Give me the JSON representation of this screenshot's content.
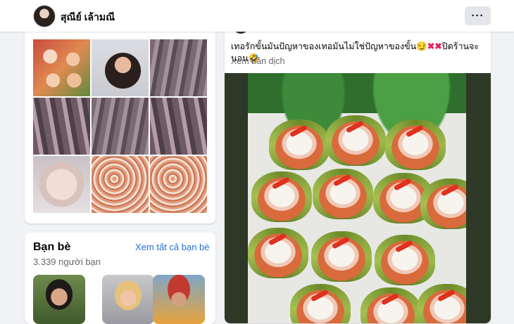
{
  "profile": {
    "name": "สุณีย์ เล้ามณี",
    "more_label": "···"
  },
  "photos": [
    {
      "icon": "food-photo"
    },
    {
      "icon": "portrait-photo"
    },
    {
      "icon": "fish-photo"
    },
    {
      "icon": "fish-photo"
    },
    {
      "icon": "fish-photo"
    },
    {
      "icon": "fish-photo"
    },
    {
      "icon": "chicken-photo"
    },
    {
      "icon": "shrimp-photo"
    },
    {
      "icon": "shrimp-photo"
    }
  ],
  "friends": {
    "title": "Bạn bè",
    "see_all": "Xem tất cả bạn bè",
    "count": "3.339 người bạn"
  },
  "post": {
    "text": "เทอรักขั้นมันปัญหาของเทอมันไม่ใช่ปัญหาของขั้น",
    "text_tail": "ปิดร้านจะนอน",
    "translate": "Xem bản dịch"
  },
  "colors": {
    "link": "#216fdb",
    "muted": "#65676b",
    "background": "#f0f2f5"
  }
}
